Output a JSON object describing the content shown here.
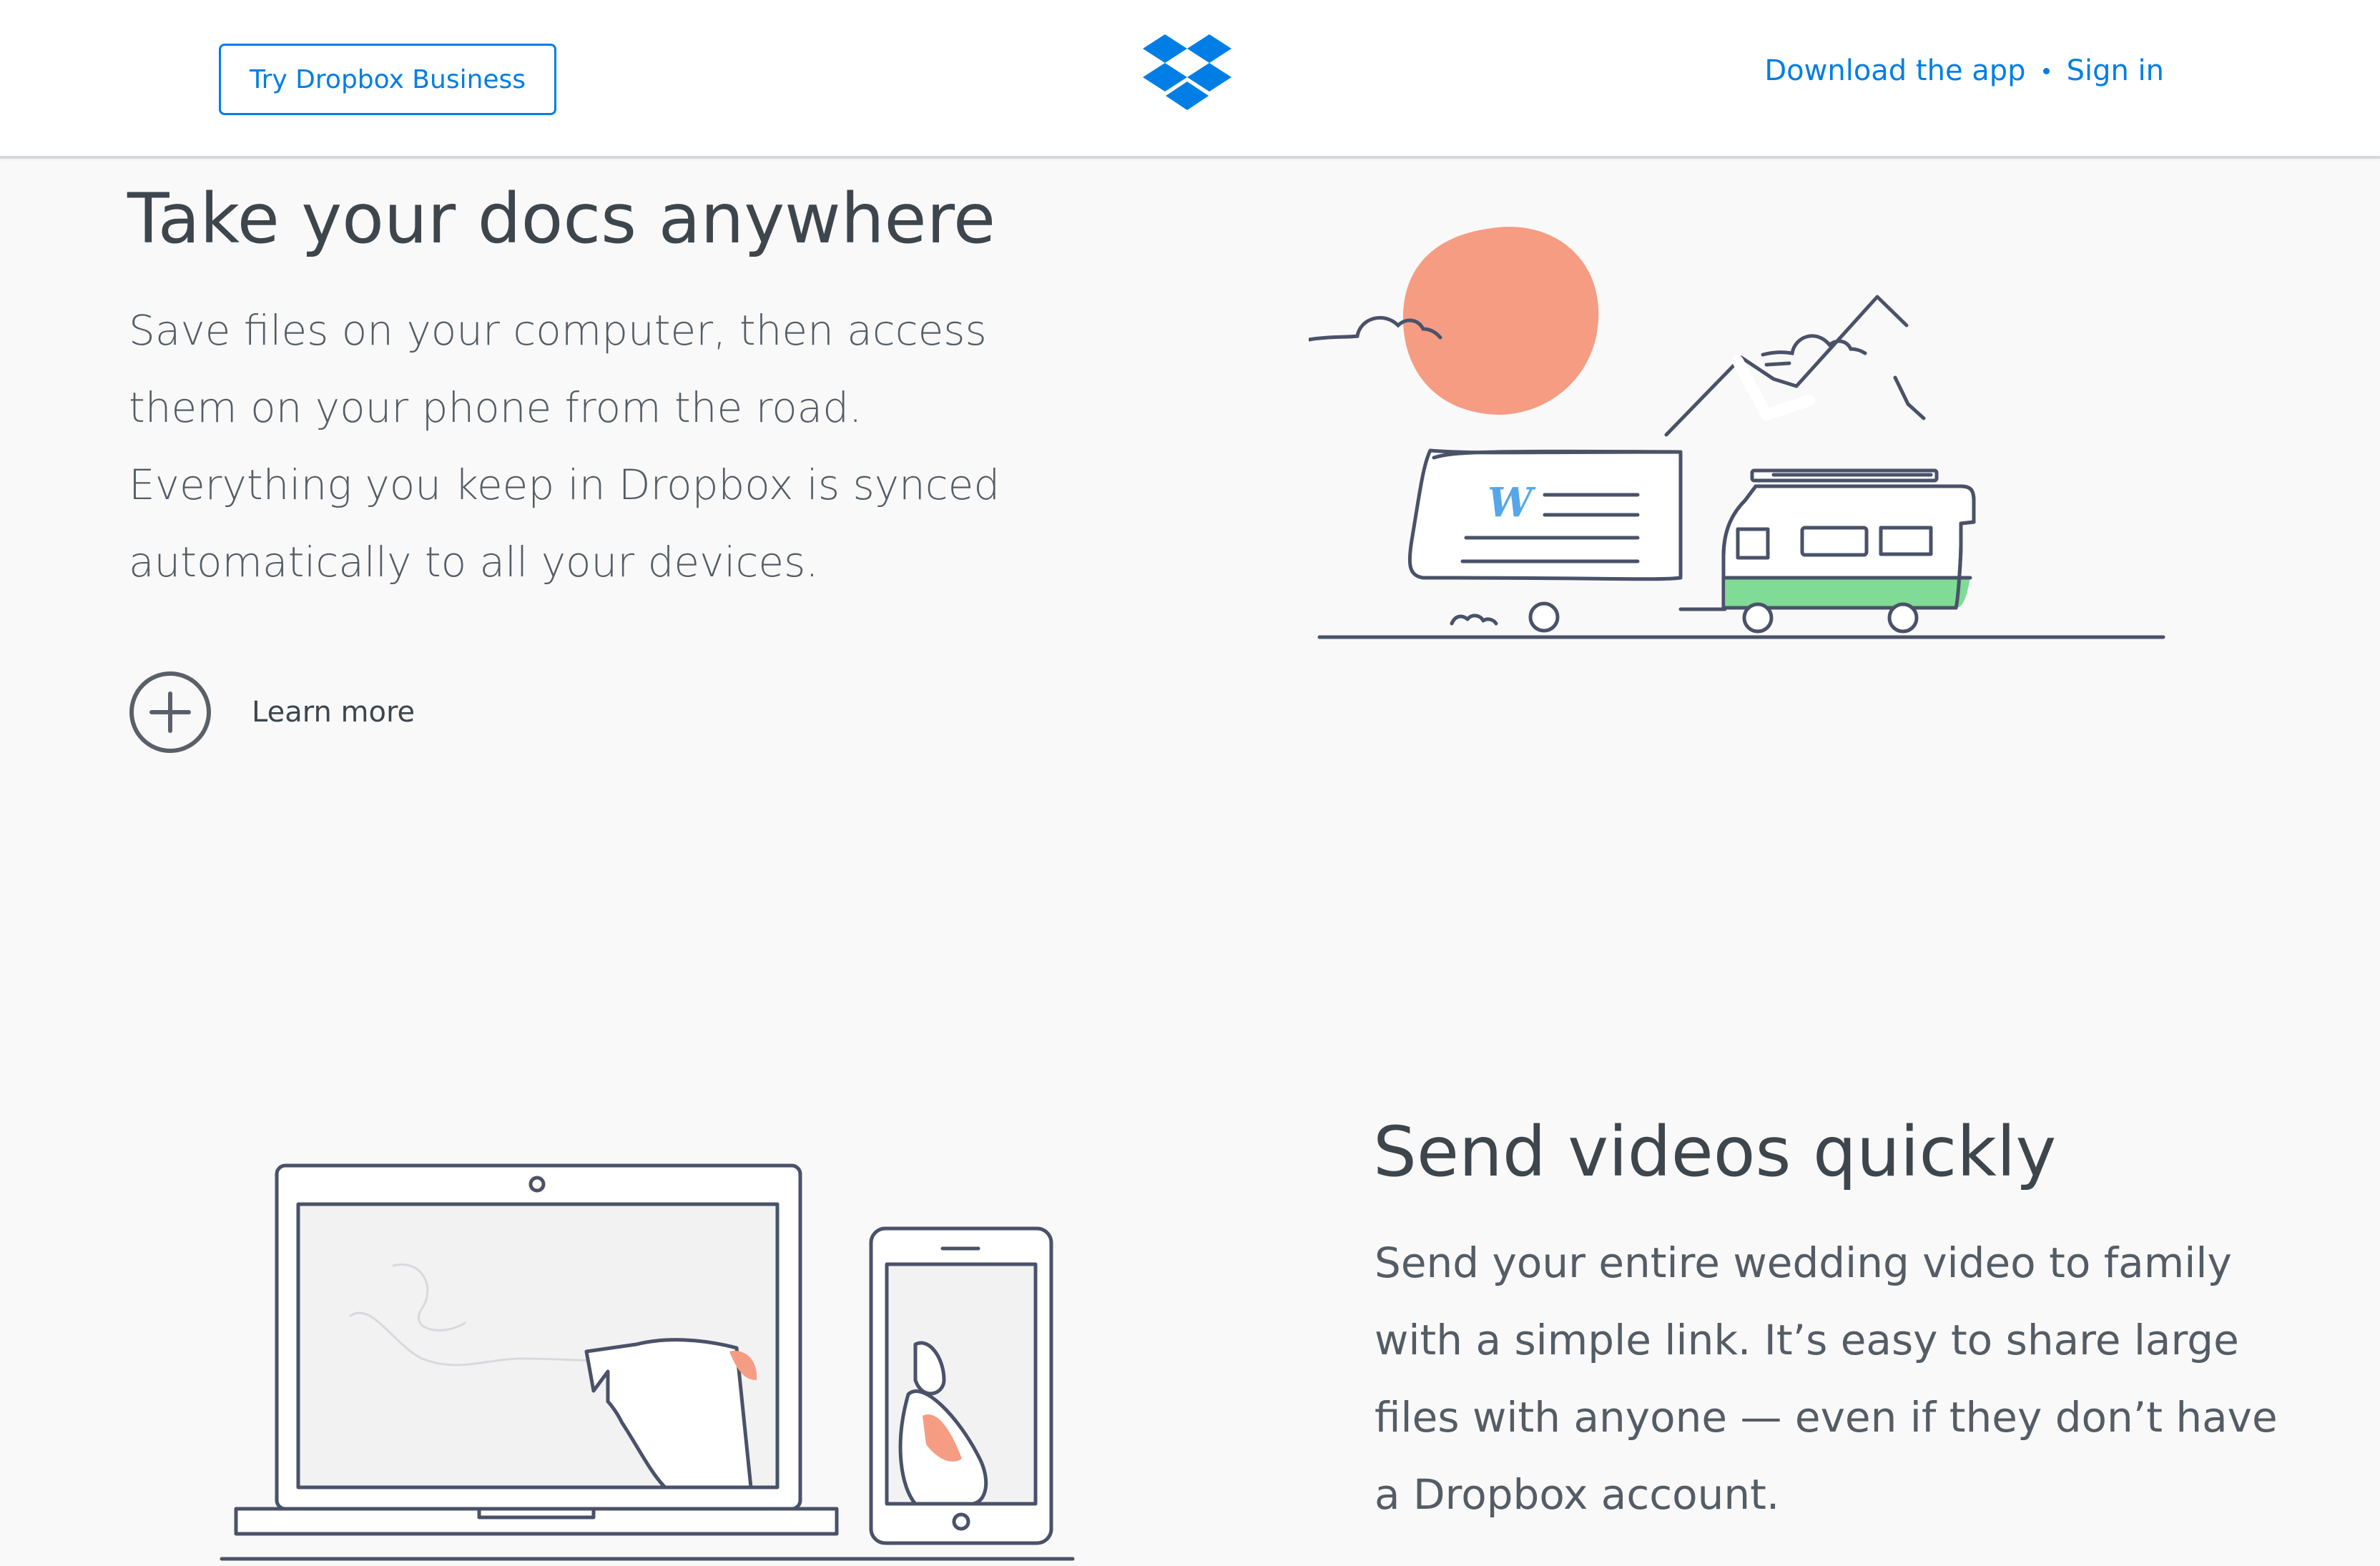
{
  "header": {
    "try_business_label": "Try Dropbox Business",
    "logo_icon": "dropbox-logo-icon",
    "download_label": "Download the app",
    "sign_in_label": "Sign in"
  },
  "section_docs": {
    "title": "Take your docs anywhere",
    "body": "Save files on your computer, then access them on your phone from the road. Everything you keep in Dropbox is synced automatically to all your devices.",
    "learn_more_label": "Learn more",
    "learn_more_icon": "plus-circle-icon",
    "doc_badge": "W"
  },
  "section_videos": {
    "title": "Send videos quickly",
    "body": "Send your entire wedding video to family with a simple link. It’s easy to share large files with anyone — even if they don’t have a Dropbox account."
  },
  "colors": {
    "brand_blue": "#007ee5",
    "sun_coral": "#f69c82",
    "camper_green": "#7fdb95",
    "line_navy": "#4a5269",
    "text_dark": "#3d464d"
  }
}
